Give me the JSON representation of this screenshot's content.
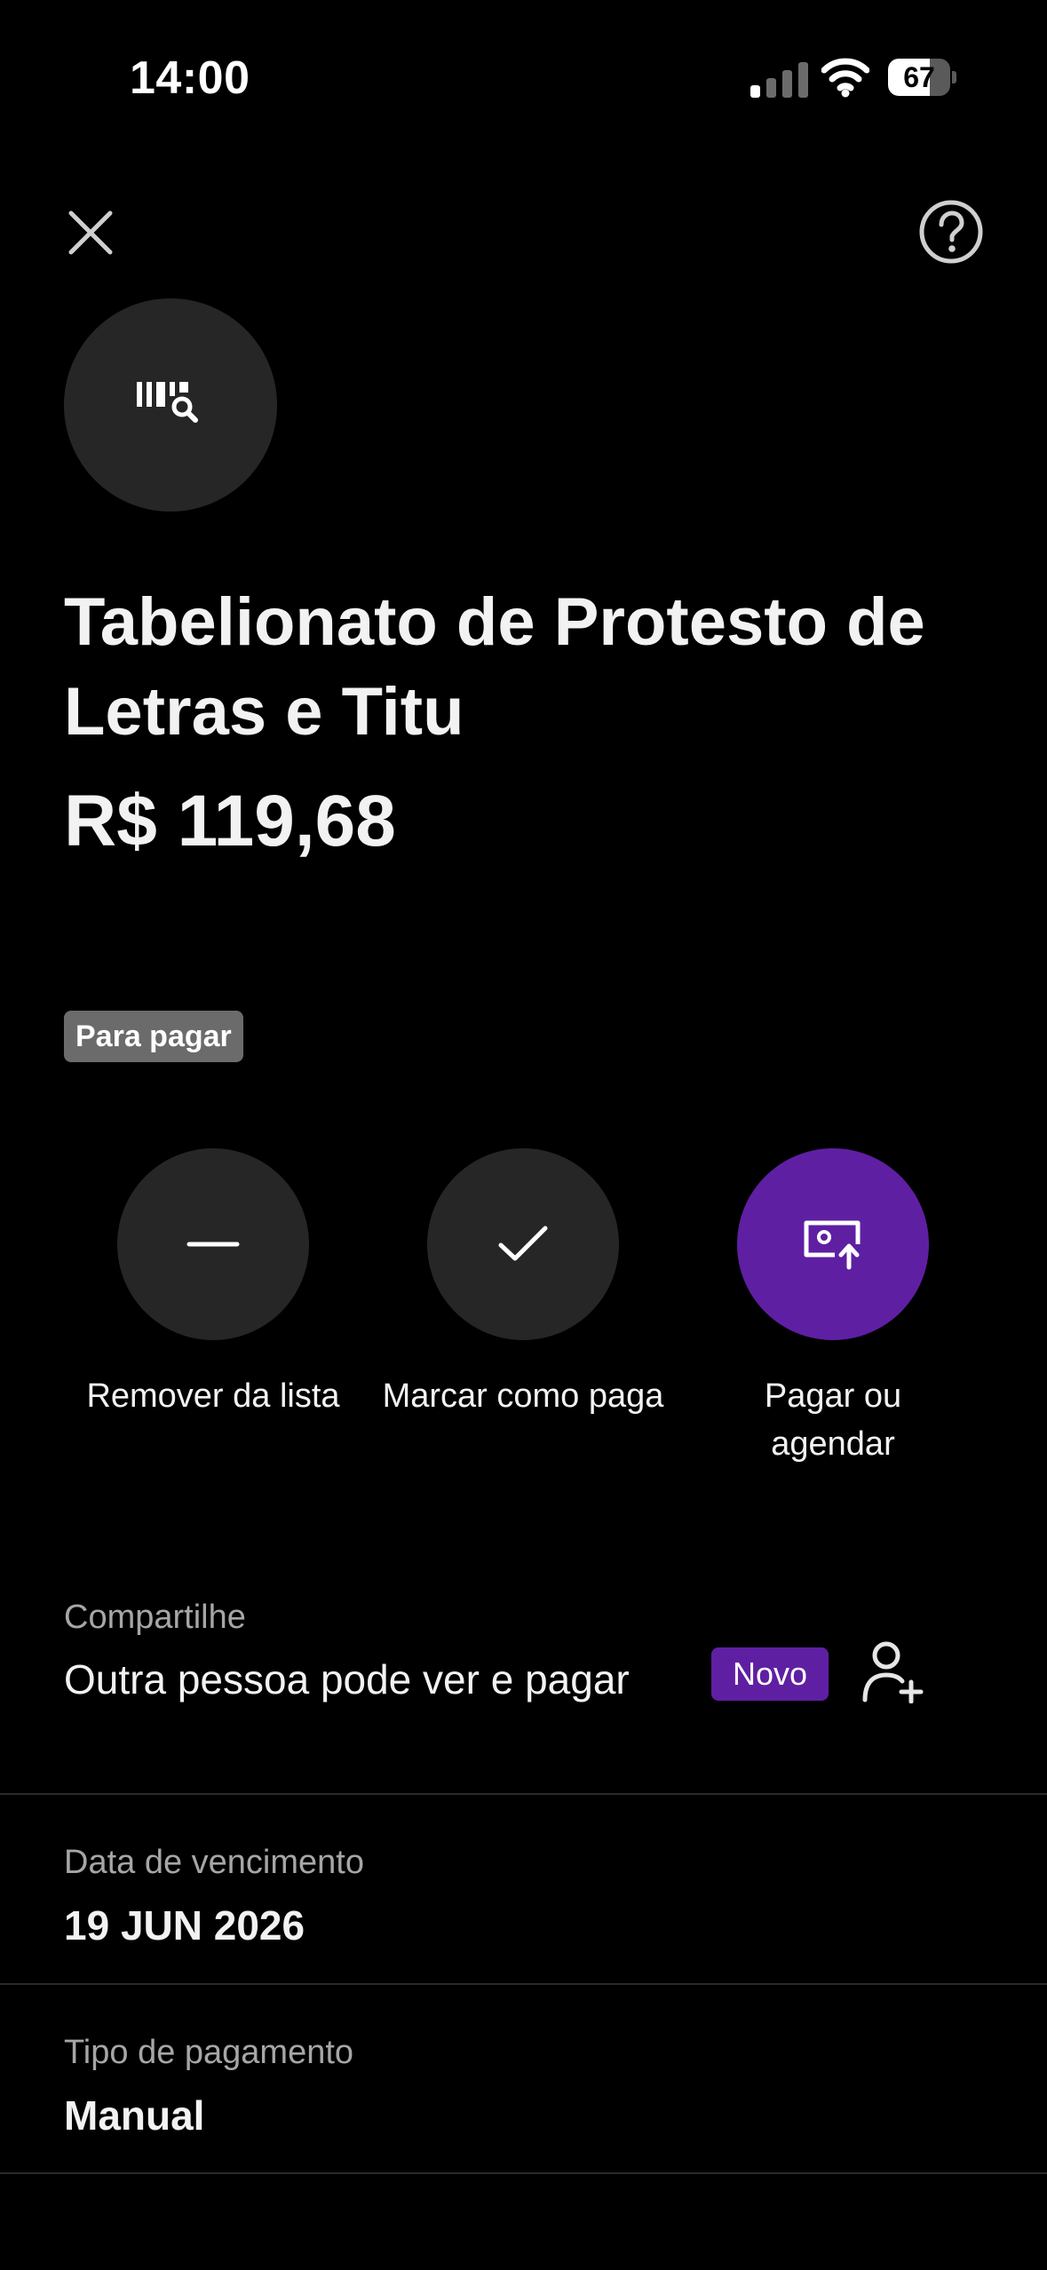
{
  "status_bar": {
    "time": "14:00",
    "battery": "67",
    "battery_level": 0.67
  },
  "nav": {
    "close_icon": "close-icon",
    "help_icon": "help-icon"
  },
  "bill": {
    "avatar_icon": "barcode-search-icon",
    "title": "Tabelionato de Protesto de Letras e Titu",
    "amount": "R$ 119,68",
    "status_tag": "Para pagar"
  },
  "actions": [
    {
      "label": "Remover da lista",
      "icon": "minus-icon"
    },
    {
      "label": "Marcar como paga",
      "icon": "check-icon"
    },
    {
      "label": "Pagar ou agendar",
      "icon": "pay-schedule-icon",
      "accent": "#5f1fa3"
    }
  ],
  "share": {
    "label": "Compartilhe",
    "text": "Outra pessoa pode ver e pagar",
    "badge": "Novo",
    "icon": "add-person-icon"
  },
  "details": {
    "due_date_label": "Data de vencimento",
    "due_date": "19 JUN 2026",
    "payment_type_label": "Tipo de pagamento",
    "payment_type": "Manual"
  },
  "colors": {
    "background": "#000000",
    "accent": "#5f1fa3",
    "surface": "#262626"
  }
}
